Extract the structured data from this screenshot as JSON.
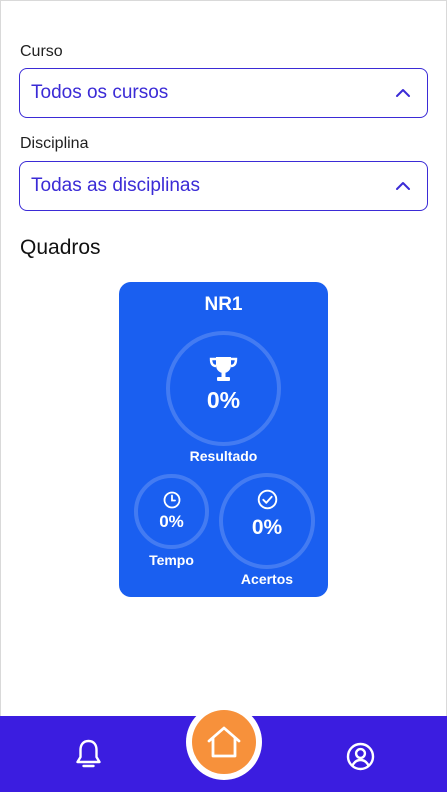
{
  "filters": {
    "curso": {
      "label": "Curso",
      "value": "Todos os cursos"
    },
    "disciplina": {
      "label": "Disciplina",
      "value": "Todas as disciplinas"
    }
  },
  "section_title": "Quadros",
  "card": {
    "title": "NR1",
    "resultado": {
      "value": "0%",
      "label": "Resultado",
      "icon": "trophy-icon"
    },
    "tempo": {
      "value": "0%",
      "label": "Tempo",
      "icon": "clock-icon"
    },
    "acertos": {
      "value": "0%",
      "label": "Acertos",
      "icon": "check-circle-icon"
    }
  },
  "nav": {
    "items": [
      "bell-icon",
      "home-icon",
      "user-circle-icon"
    ]
  },
  "colors": {
    "accent": "#3b2bd6",
    "card": "#1a5ff0",
    "nav": "#3b1de0",
    "home": "#f7913b"
  }
}
